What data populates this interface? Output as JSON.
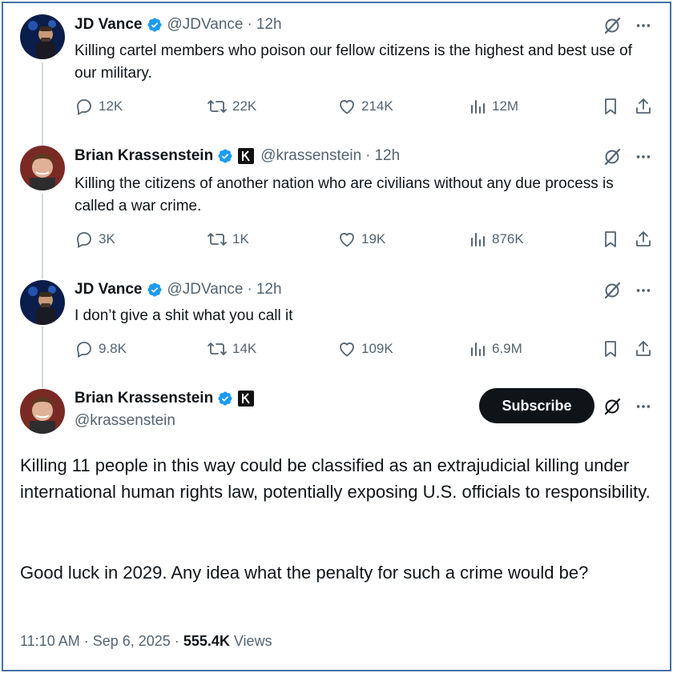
{
  "tweets": [
    {
      "name": "JD Vance",
      "handle": "@JDVance",
      "sep": "·",
      "time": "12h",
      "text": "Killing cartel members who poison our fellow citizens is the highest and best use of our military.",
      "replies": "12K",
      "retweets": "22K",
      "likes": "214K",
      "views": "12M"
    },
    {
      "name": "Brian Krassenstein",
      "handle": "@krassenstein",
      "sep": "·",
      "time": "12h",
      "text": "Killing the citizens of another nation who are civilians without any due process is called a war crime.",
      "replies": "3K",
      "retweets": "1K",
      "likes": "19K",
      "views": "876K"
    },
    {
      "name": "JD Vance",
      "handle": "@JDVance",
      "sep": "·",
      "time": "12h",
      "text": "I don’t give a shit what you call it",
      "replies": "9.8K",
      "retweets": "14K",
      "likes": "109K",
      "views": "6.9M"
    }
  ],
  "main": {
    "name": "Brian Krassenstein",
    "handle": "@krassenstein",
    "subscribe_label": "Subscribe",
    "paragraph1": "Killing 11 people in this way could be classified as an extrajudicial killing under international human rights law, potentially exposing U.S. officials to responsibility.",
    "paragraph2": "Good luck in 2029.  Any idea what the penalty for such a crime would be?",
    "timestamp": "11:10 AM · Sep 6, 2025 ·",
    "views_count": "555.4K",
    "views_label": "Views"
  },
  "colors": {
    "verified": "#1d9bf0",
    "text_primary": "#0f1419",
    "text_secondary": "#536471",
    "border": "#4a6fa5"
  },
  "icons": [
    "verified-badge-icon",
    "grok-icon",
    "more-icon",
    "reply-icon",
    "retweet-icon",
    "like-icon",
    "views-icon",
    "bookmark-icon",
    "share-icon"
  ]
}
